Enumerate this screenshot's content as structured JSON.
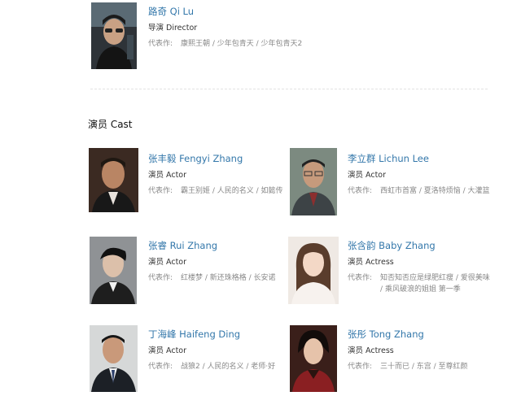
{
  "director": {
    "name": "路奇 Qi Lu",
    "role": "导演 Director",
    "works_label": "代表作:",
    "works": "康熙王朝 / 少年包青天 / 少年包青天2"
  },
  "cast_section": {
    "title": "演员 Cast"
  },
  "cast": [
    {
      "name": "张丰毅 Fengyi Zhang",
      "role": "演员 Actor",
      "works_label": "代表作:",
      "works": "霸王别姬 / 人民的名义 / 如懿传"
    },
    {
      "name": "李立群 Lichun Lee",
      "role": "演员 Actor",
      "works_label": "代表作:",
      "works": "西虹市首富 / 夏洛特烦恼 / 大灌篮"
    },
    {
      "name": "张睿 Rui Zhang",
      "role": "演员 Actor",
      "works_label": "代表作:",
      "works": "红楼梦 / 新还珠格格 / 长安诺"
    },
    {
      "name": "张含韵 Baby Zhang",
      "role": "演员 Actress",
      "works_label": "代表作:",
      "works": "知否知否应是绿肥红瘦 / 爱很美味 / 乘风破浪的姐姐 第一季"
    },
    {
      "name": "丁海峰 Haifeng Ding",
      "role": "演员 Actor",
      "works_label": "代表作:",
      "works": "战狼2 / 人民的名义 / 老师·好"
    },
    {
      "name": "张彤 Tong Zhang",
      "role": "演员 Actress",
      "works_label": "代表作:",
      "works": "三十而已 / 东宫 / 至尊红颜"
    }
  ]
}
